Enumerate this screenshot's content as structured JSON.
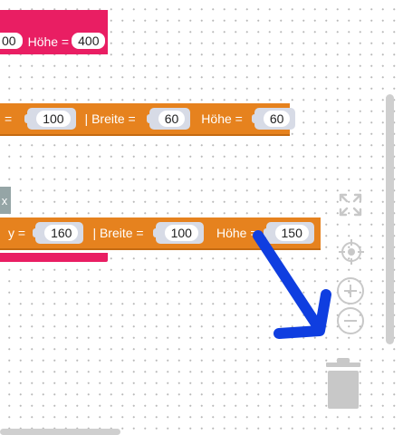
{
  "block1": {
    "x_tail": "00",
    "hoehe_label": "Höhe =",
    "hoehe_value": "400"
  },
  "block2": {
    "eq_label": "=",
    "x_value": "100",
    "breite_label": "| Breite =",
    "breite_value": "60",
    "hoehe_label": "Höhe =",
    "hoehe_value": "60"
  },
  "block3": {
    "y_label": "y =",
    "y_value": "160",
    "breite_label": "| Breite =",
    "breite_value": "100",
    "hoehe_label": "Höhe =",
    "hoehe_value": "150"
  },
  "grey_tab_label": "x",
  "colors": {
    "pink": "#e91e63",
    "orange": "#e6821e",
    "arrow": "#0f3ee0",
    "slot": "#d7dbe6"
  },
  "icons": [
    "fullscreen-icon",
    "center-target-icon",
    "zoom-in-icon",
    "zoom-out-icon",
    "trash-icon"
  ]
}
